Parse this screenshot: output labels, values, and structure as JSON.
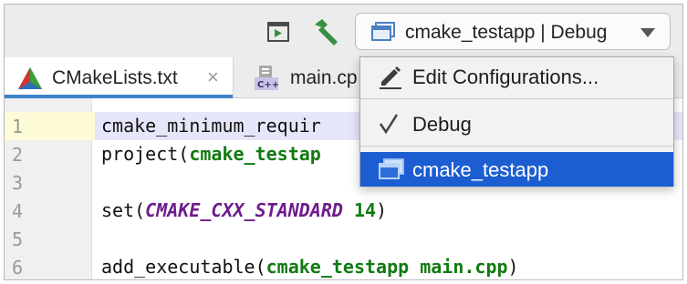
{
  "toolbar": {
    "run_config_selector": "cmake_testapp | Debug"
  },
  "tabs": [
    {
      "label": "CMakeLists.txt",
      "close": "×",
      "active": true,
      "icon": "cmake-icon"
    },
    {
      "label": "main.cp",
      "active": false,
      "icon": "cpp-file-icon",
      "badge": "C++"
    }
  ],
  "dropdown": {
    "items": [
      {
        "label": "Edit Configurations...",
        "icon": "pencil-icon"
      },
      {
        "label": "Debug",
        "icon": "check-icon",
        "checked": true
      },
      {
        "label": "cmake_testapp",
        "icon": "app-window-icon",
        "selected": true
      }
    ]
  },
  "editor": {
    "line_numbers": [
      "1",
      "2",
      "3",
      "4",
      "5",
      "6"
    ],
    "lines": [
      {
        "plain": "cmake_minimum_requir"
      },
      {
        "plain": "project(",
        "kw": "cmake_testap"
      },
      {
        "plain": ""
      },
      {
        "plain": "set(",
        "var": "CMAKE_CXX_STANDARD",
        "sp": " ",
        "num": "14",
        "close": ")"
      },
      {
        "plain": ""
      },
      {
        "plain": "add_executable(",
        "kw": "cmake_testapp main.cpp",
        "close": ")"
      }
    ]
  },
  "colors": {
    "accent_blue": "#1c5ed1",
    "tab_underline": "#4083c9",
    "keyword_green": "#117a11",
    "variable_purple": "#6e1c8c",
    "build_hammer_green": "#3a8f45"
  }
}
